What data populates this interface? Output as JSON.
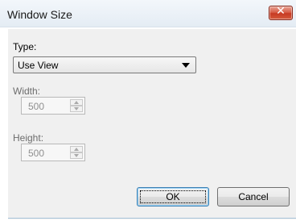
{
  "window": {
    "title": "Window Size"
  },
  "type_field": {
    "label": "Type:",
    "selected": "Use View"
  },
  "width_field": {
    "label": "Width:",
    "value": "500"
  },
  "height_field": {
    "label": "Height:",
    "value": "500"
  },
  "buttons": {
    "ok": "OK",
    "cancel": "Cancel"
  },
  "icons": {
    "close": "close-icon",
    "dropdown": "chevron-down-icon",
    "spin_up": "spin-up-icon",
    "spin_down": "spin-down-icon"
  },
  "colors": {
    "titlebar": "#e4ecf4",
    "close_button": "#c73a23",
    "client_bg": "#f0f0f0"
  }
}
